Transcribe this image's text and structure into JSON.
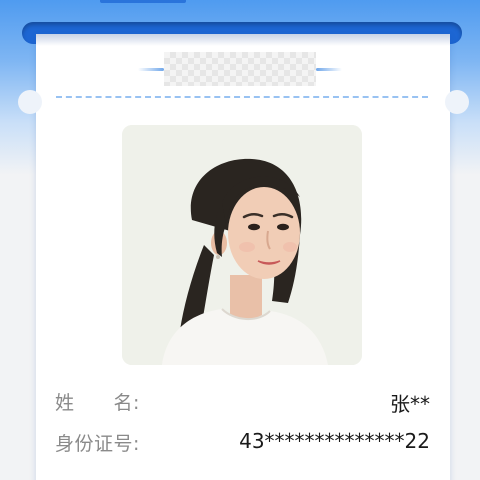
{
  "card": {
    "fields": [
      {
        "label": "姓　　名:",
        "value": "张**"
      },
      {
        "label": "身份证号:",
        "value": "43**************22"
      }
    ]
  },
  "photo": {
    "icon": "person-portrait",
    "background": "#eff1ea"
  },
  "colors": {
    "accent": "#4f9bf0",
    "slot": "#1d66d3",
    "dashed_divider": "#98c2f2",
    "label_text": "#8a8a8a",
    "value_text": "#1a1a1a"
  }
}
